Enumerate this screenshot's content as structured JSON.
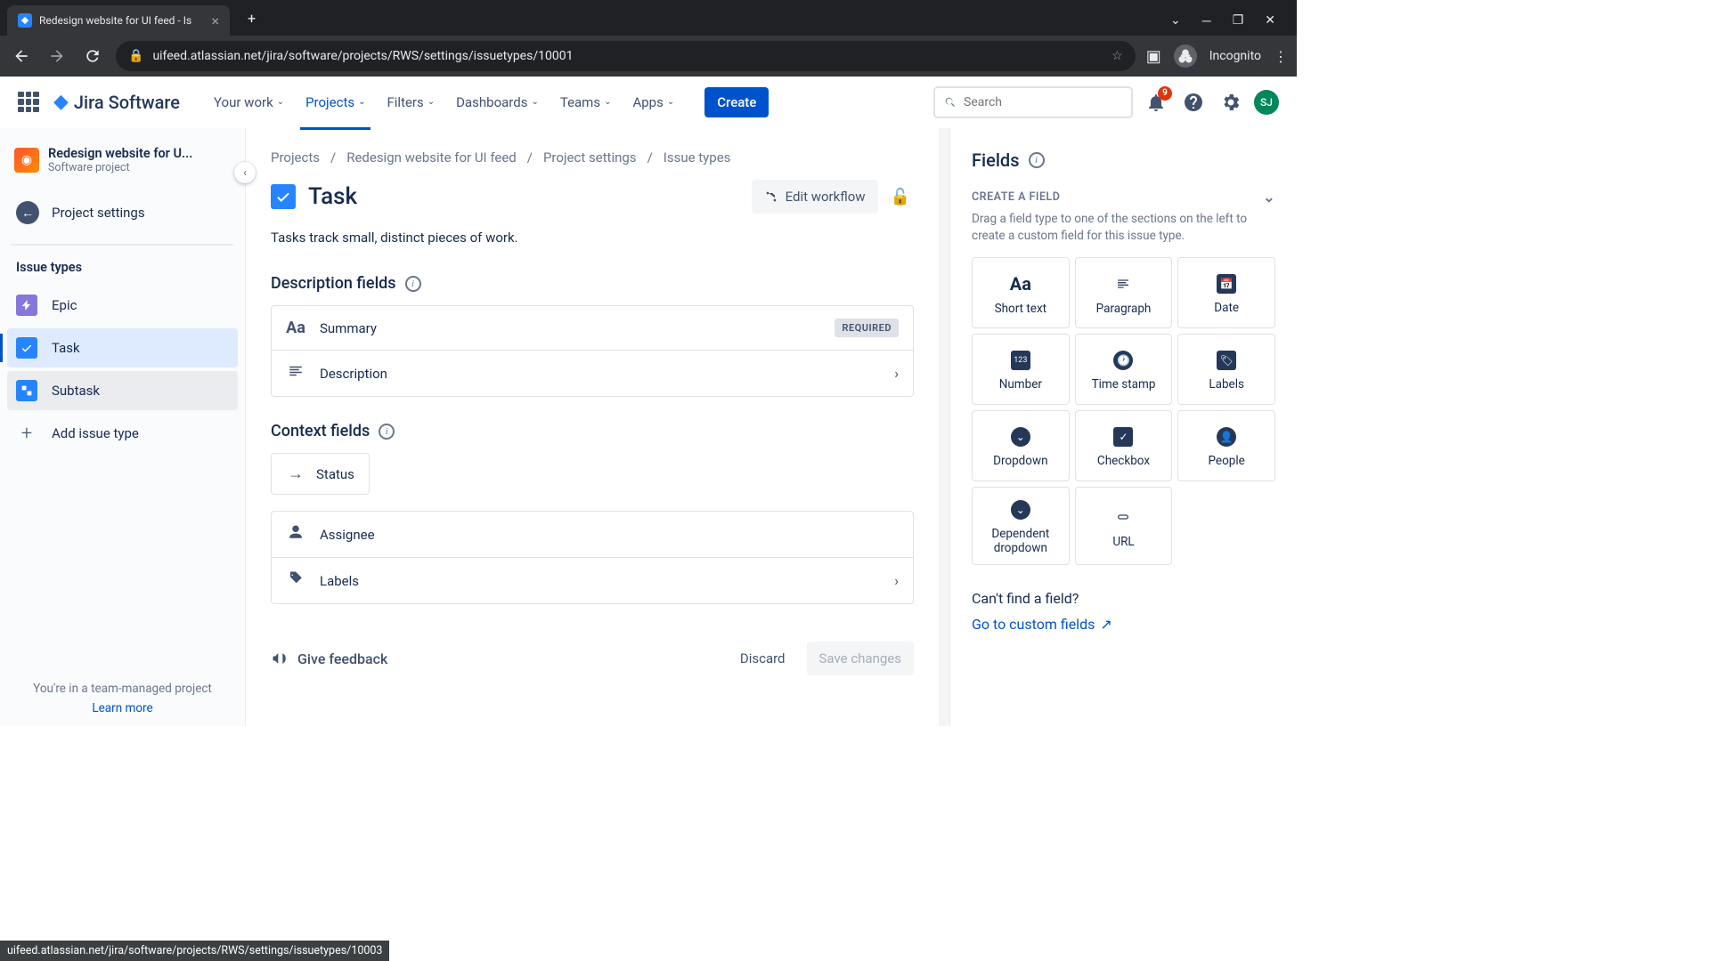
{
  "browser": {
    "tab_title": "Redesign website for UI feed - Is",
    "url": "uifeed.atlassian.net/jira/software/projects/RWS/settings/issuetypes/10001",
    "incognito": "Incognito",
    "status_tip": "uifeed.atlassian.net/jira/software/projects/RWS/settings/issuetypes/10003"
  },
  "logo": "Jira Software",
  "nav": {
    "your_work": "Your work",
    "projects": "Projects",
    "filters": "Filters",
    "dashboards": "Dashboards",
    "teams": "Teams",
    "apps": "Apps"
  },
  "create_btn": "Create",
  "search_placeholder": "Search",
  "notification_count": "9",
  "user_initials": "SJ",
  "sidebar": {
    "project_name": "Redesign website for U...",
    "project_type": "Software project",
    "back": "Project settings",
    "section": "Issue types",
    "items": {
      "epic": "Epic",
      "task": "Task",
      "subtask": "Subtask",
      "add": "Add issue type"
    },
    "footer": "You're in a team-managed project",
    "learn_more": "Learn more"
  },
  "breadcrumbs": [
    "Projects",
    "Redesign website for UI feed",
    "Project settings",
    "Issue types"
  ],
  "issue": {
    "title": "Task",
    "edit_workflow": "Edit workflow",
    "description": "Tasks track small, distinct pieces of work."
  },
  "sections": {
    "description_fields": "Description fields",
    "context_fields": "Context fields"
  },
  "fields": {
    "summary": "Summary",
    "required": "REQUIRED",
    "description": "Description",
    "status": "Status",
    "assignee": "Assignee",
    "labels": "Labels"
  },
  "footer": {
    "feedback": "Give feedback",
    "discard": "Discard",
    "save": "Save changes"
  },
  "panel": {
    "title": "Fields",
    "create_header": "CREATE A FIELD",
    "create_desc": "Drag a field type to one of the sections on the left to create a custom field for this issue type.",
    "types": {
      "short_text": "Short text",
      "paragraph": "Paragraph",
      "date": "Date",
      "number": "Number",
      "timestamp": "Time stamp",
      "labels": "Labels",
      "dropdown": "Dropdown",
      "checkbox": "Checkbox",
      "people": "People",
      "dependent": "Dependent dropdown",
      "url": "URL"
    },
    "cant_find": "Can't find a field?",
    "custom_link": "Go to custom fields"
  }
}
